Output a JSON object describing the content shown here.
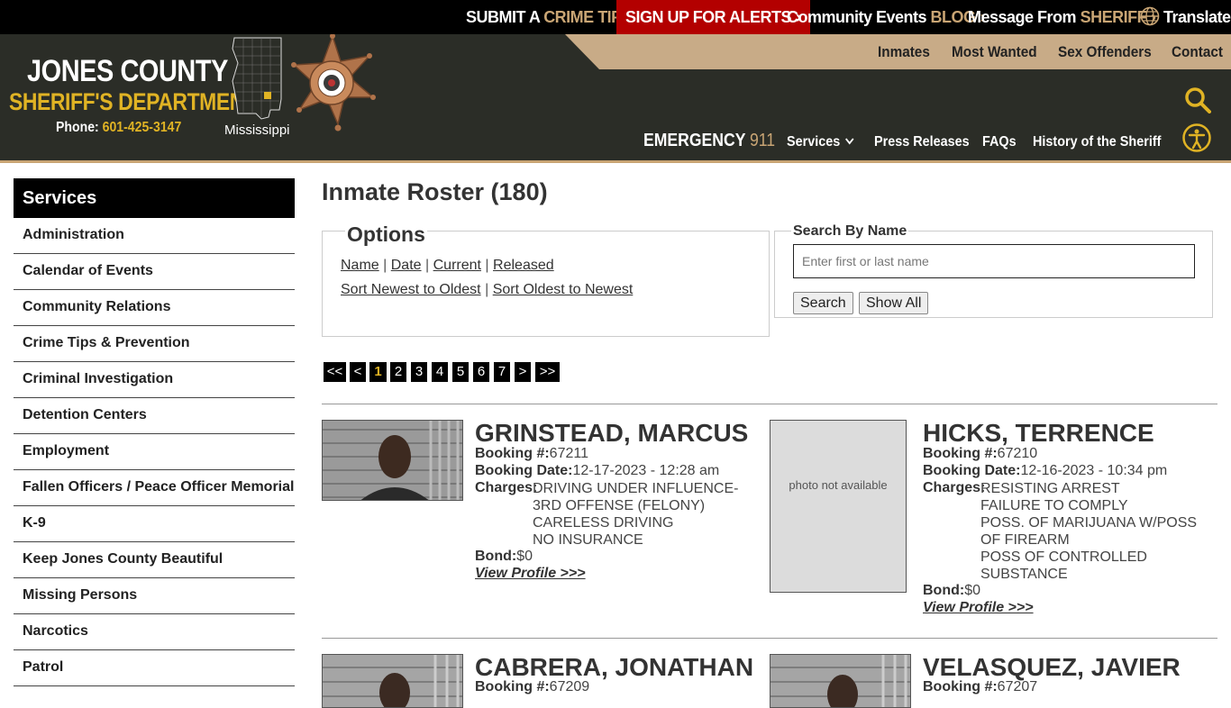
{
  "topbar": {
    "submit_a": "SUBMIT A",
    "crime_tip": "CRIME TIP",
    "alerts": "SIGN UP FOR ALERTS",
    "community_events": "Community Events",
    "blog": "BLOG",
    "message_from": "Message From",
    "sheriff": "SHERIFF",
    "translate": "Translate",
    "chevron": "›"
  },
  "header": {
    "title": "JONES COUNTY",
    "subtitle": "SHERIFF'S DEPARTMENT",
    "phone_label": "Phone:",
    "phone": "601-425-3147",
    "state": "Mississippi",
    "emergency_label": "EMERGENCY",
    "emergency_num": "911",
    "subnav": [
      "Inmates",
      "Most Wanted",
      "Sex Offenders",
      "Contact"
    ],
    "mainnav": [
      "Services",
      "Press Releases",
      "FAQs",
      "History of the Sheriff"
    ],
    "services_caret": "⌄"
  },
  "sidebar": {
    "heading": "Services",
    "items": [
      "Administration",
      "Calendar of Events",
      "Community Relations",
      "Crime Tips & Prevention",
      "Criminal Investigation",
      "Detention Centers",
      "Employment",
      "Fallen Officers / Peace Officer Memorial",
      "K-9",
      "Keep Jones County Beautiful",
      "Missing Persons",
      "Narcotics",
      "Patrol"
    ]
  },
  "main": {
    "title": "Inmate Roster (180)",
    "options": {
      "legend": "Options",
      "sort_name": "Name",
      "sort_date": "Date",
      "filter_current": "Current",
      "filter_released": "Released",
      "sort_newest": "Sort Newest to Oldest",
      "sort_oldest": "Sort Oldest to Newest",
      "sep": "|"
    },
    "search": {
      "legend": "Search By Name",
      "placeholder": "Enter first or last name",
      "search_btn": "Search",
      "show_all_btn": "Show All"
    },
    "pager": [
      "<<",
      "<",
      "1",
      "2",
      "3",
      "4",
      "5",
      "6",
      "7",
      ">",
      ">>"
    ],
    "current_page": "1",
    "labels": {
      "booking_no": "Booking #:",
      "booking_date": "Booking Date:",
      "charges": "Charges:",
      "bond": "Bond:",
      "view_profile": "View Profile >>>",
      "photo_na": "photo not available"
    },
    "inmates": [
      {
        "name": "GRINSTEAD, MARCUS",
        "booking_no": "67211",
        "booking_date": "12-17-2023 - 12:28 am",
        "charges": [
          "DRIVING UNDER INFLUENCE-3RD OFFENSE (FELONY)",
          "CARELESS DRIVING",
          "NO INSURANCE"
        ],
        "bond": "$0"
      },
      {
        "name": "HICKS, TERRENCE",
        "booking_no": "67210",
        "booking_date": "12-16-2023 - 10:34 pm",
        "charges": [
          "RESISTING ARREST",
          "FAILURE TO COMPLY",
          "POSS. OF MARIJUANA W/POSS OF FIREARM",
          "POSS OF CONTROLLED SUBSTANCE"
        ],
        "bond": "$0"
      },
      {
        "name": "CABRERA, JONATHAN",
        "booking_no": "67209"
      },
      {
        "name": "VELASQUEZ, JAVIER",
        "booking_no": "67207"
      }
    ]
  }
}
